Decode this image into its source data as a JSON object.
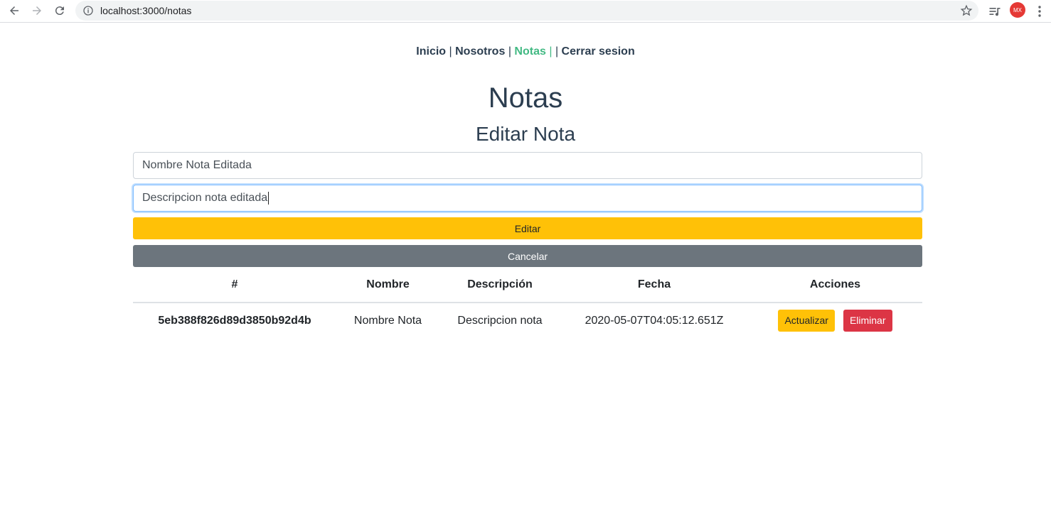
{
  "browser": {
    "url": "localhost:3000/notas",
    "profile_initials": "MX"
  },
  "nav": {
    "items": [
      "Inicio",
      "Nosotros",
      "Notas",
      "Cerrar sesion"
    ],
    "separator": "|"
  },
  "page": {
    "title": "Notas",
    "subtitle": "Editar Nota"
  },
  "form": {
    "name_value": "Nombre Nota Editada",
    "description_value": "Descripcion nota editada",
    "submit_label": "Editar",
    "cancel_label": "Cancelar"
  },
  "table": {
    "headers": [
      "#",
      "Nombre",
      "Descripción",
      "Fecha",
      "Acciones"
    ],
    "rows": [
      {
        "id": "5eb388f826d89d3850b92d4b",
        "nombre": "Nombre Nota",
        "descripcion": "Descripcion nota",
        "fecha": "2020-05-07T04:05:12.651Z",
        "update_label": "Actualizar",
        "delete_label": "Eliminar"
      }
    ]
  },
  "colors": {
    "text": "#2c3e50",
    "active_link": "#42b983",
    "warning": "#ffc107",
    "secondary": "#6c757d",
    "danger": "#dc3545"
  }
}
